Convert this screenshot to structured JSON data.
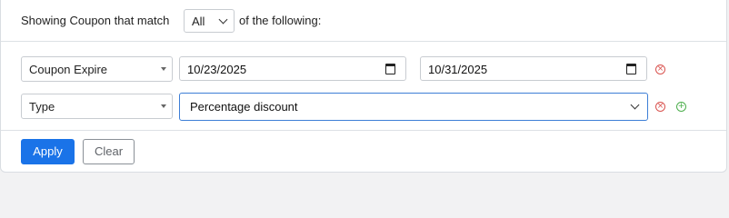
{
  "filter_header": {
    "prefix": "Showing Coupon that match",
    "match_mode": "All",
    "suffix": "of the following:"
  },
  "conditions": [
    {
      "field": "Coupon Expire",
      "start_date": "10/23/2025",
      "end_date": "10/31/2025"
    },
    {
      "field": "Type",
      "value": "Percentage discount"
    }
  ],
  "actions": {
    "apply_label": "Apply",
    "clear_label": "Clear"
  },
  "icons": {
    "calendar": "calendar-icon",
    "remove": "remove-condition-icon",
    "add": "add-condition-icon"
  },
  "colors": {
    "primary": "#1a73e8",
    "remove": "#d9534f",
    "add": "#4cae4c",
    "focus_border": "#3d7ed6"
  }
}
